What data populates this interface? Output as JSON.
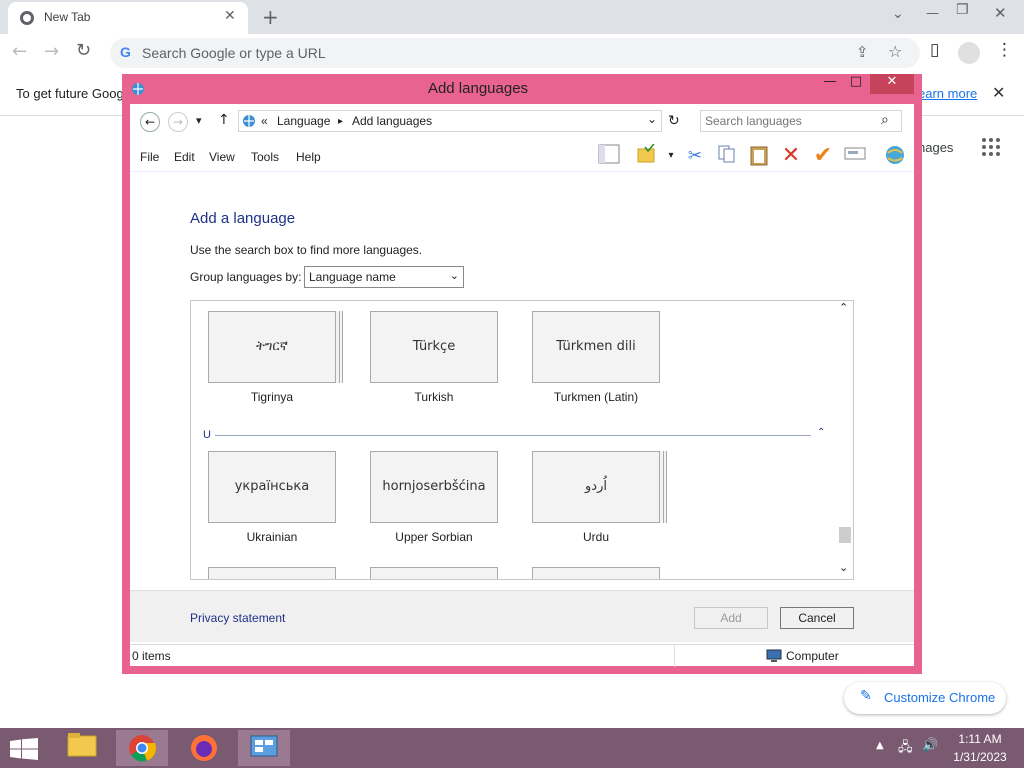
{
  "chrome": {
    "tab_title": "New Tab",
    "tab_close": "✕",
    "new_tab": "+",
    "omnibox_placeholder": "Search Google or type a URL",
    "omnibox_g": "G",
    "infobar_text": "To get future Goog",
    "infobar_link": "earn more",
    "infobar_close": "✕",
    "ntp_right_text": "nages",
    "customize_label": "Customize Chrome",
    "customize_icon": "✎",
    "window_minimize": "—",
    "window_restore": "❐",
    "window_close": "✕",
    "chevron_down": "⌄",
    "back": "←",
    "forward": "→",
    "reload": "↻",
    "share": "⇪",
    "star": "☆",
    "sidepanel": "▯",
    "profile": "●",
    "kebab": "⋮"
  },
  "dialog": {
    "title": "Add languages",
    "minimize": "—",
    "maximize": "□",
    "close": "✕",
    "nav": {
      "back": "←",
      "forward": "→",
      "dropdown": "▾",
      "up": "↑",
      "refresh": "↻",
      "address_dropdown": "⌄",
      "breadcrumb_chevrons": "«",
      "crumbs": [
        "Language",
        "Add languages"
      ],
      "crumb_sep": "▸"
    },
    "search_placeholder": "Search languages",
    "search_icon": "⌕",
    "menu": [
      "File",
      "Edit",
      "View",
      "Tools",
      "Help"
    ],
    "toolbar_icons": [
      "layout-pane-icon",
      "properties-folder-icon",
      "cut-icon",
      "copy-icon",
      "paste-icon",
      "delete-icon",
      "check-icon",
      "rename-icon",
      "globe-icon"
    ],
    "heading": "Add a language",
    "description": "Use the search box to find more languages.",
    "group_label": "Group languages by:",
    "group_value": "Language name",
    "languages_row1": [
      {
        "native": "ትግርኛ",
        "name": "Tigrinya",
        "stack": true
      },
      {
        "native": "Türkçe",
        "name": "Turkish",
        "stack": false
      },
      {
        "native": "Türkmen dili",
        "name": "Turkmen (Latin)",
        "stack": false
      }
    ],
    "group_u_label": "U",
    "group_u_chevron": "⌃",
    "languages_row2": [
      {
        "native": "українська",
        "name": "Ukrainian",
        "stack": false
      },
      {
        "native": "hornjoserbšćina",
        "name": "Upper Sorbian",
        "stack": false
      },
      {
        "native": "اُردو",
        "name": "Urdu",
        "stack": true
      }
    ],
    "scroll_up": "⌃",
    "scroll_down": "⌄",
    "privacy": "Privacy statement",
    "add": "Add",
    "cancel": "Cancel",
    "status_items": "0 items",
    "status_location": "Computer"
  },
  "taskbar": {
    "time": "1:11 AM",
    "date": "1/31/2023",
    "apps": [
      "file-explorer-icon",
      "chrome-icon",
      "firefox-icon",
      "control-panel-icon"
    ]
  }
}
